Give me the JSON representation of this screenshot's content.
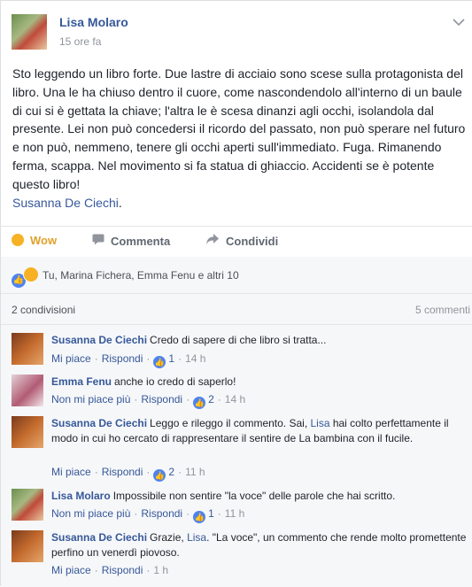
{
  "post": {
    "author": "Lisa Molaro",
    "time": "15 ore fa",
    "body": "Sto leggendo un libro forte. Due lastre di acciaio sono scese sulla protagonista del libro. Una le ha chiuso dentro il cuore, come nascondendolo all'interno di un baule di cui si è gettata la chiave; l'altra le è scesa dinanzi agli occhi, isolandola dal presente. Lei non può concedersi il ricordo del passato, non può sperare nel futuro e non può, nemmeno, tenere gli occhi aperti sull'immediato. Fuga. Rimanendo ferma, scappa. Nel movimento si fa statua di ghiaccio. Accidenti se è potente questo libro!",
    "tag": "Susanna De Ciechi",
    "tag_suffix": "."
  },
  "actions": {
    "wow": "Wow",
    "comment": "Commenta",
    "share": "Condividi"
  },
  "reactions": {
    "text": "Tu, Marina Fichera, Emma Fenu e altri 10"
  },
  "stats": {
    "shares": "2 condivisioni",
    "comments": "5 commenti"
  },
  "comments": [
    {
      "name": "Susanna De Ciechi",
      "text": "Credo di sapere di che libro si tratta...",
      "like": "Mi piace",
      "reply": "Rispondi",
      "count": "1",
      "time": "14 h"
    },
    {
      "name": "Emma Fenu",
      "text": "anche io credo di saperlo!",
      "like": "Non mi piace più",
      "reply": "Rispondi",
      "count": "2",
      "time": "14 h"
    },
    {
      "name": "Susanna De Ciechi",
      "text_before": "Leggo e rileggo il commento. Sai, ",
      "mention": "Lisa",
      "text_after": " hai colto perfettamente il modo in cui ho cercato di rappresentare il sentire de La bambina con il fucile.",
      "like": "Mi piace",
      "reply": "Rispondi",
      "count": "2",
      "time": "11 h"
    },
    {
      "name": "Lisa Molaro",
      "text": "Impossibile non sentire \"la voce\" delle parole che hai scritto.",
      "like": "Non mi piace più",
      "reply": "Rispondi",
      "count": "1",
      "time": "11 h"
    },
    {
      "name": "Susanna De Ciechi",
      "text_before": "Grazie, ",
      "mention": "Lisa",
      "text_after": ". \"La voce\", un commento che rende molto promettente perfino un venerdì piovoso.",
      "like": "Mi piace",
      "reply": "Rispondi",
      "time": "1 h"
    }
  ],
  "icons": {
    "chevron": "chevron-down-icon",
    "comment": "comment-icon",
    "share": "share-icon",
    "like": "like-icon",
    "wow": "wow-icon"
  }
}
